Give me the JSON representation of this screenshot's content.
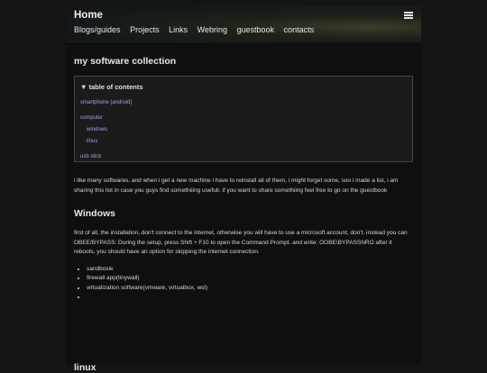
{
  "header": {
    "home": "Home",
    "nav": [
      "Blogs/guides",
      "Projects",
      "Links",
      "Webring",
      "guestbook",
      "contacts"
    ]
  },
  "main": {
    "title": "my software collection",
    "toc": {
      "title": "▼  table of contents",
      "items": [
        "smartphone (android)",
        "computer",
        "windows",
        "linux",
        "usb stick"
      ]
    },
    "intro": "i like many softwares, and when i get a new machine i have to reinstall all of them, i might forget some, soo i made a list, i am sharing this list in case you guys find somethiiing usefull. if you want to share somethiing feel free to go on the guestbook",
    "windows": {
      "heading": "Windows",
      "text": "first of all, the installation, don't connect to the internet, otherwise you will have to use a microsoft account, don't. instead you can OBEE/BYPASS: During the setup, press Shift + F10 to open the Command Prompt. and write: OOBE\\BYPASSNRO after it reboots, you should have an option for skipping the internet connection.",
      "list": [
        "sandboxie",
        "firewall app(tinywall)",
        "virtualization software(vmware, virtualbox, wsl)",
        ""
      ]
    },
    "linux_heading": "linux"
  }
}
